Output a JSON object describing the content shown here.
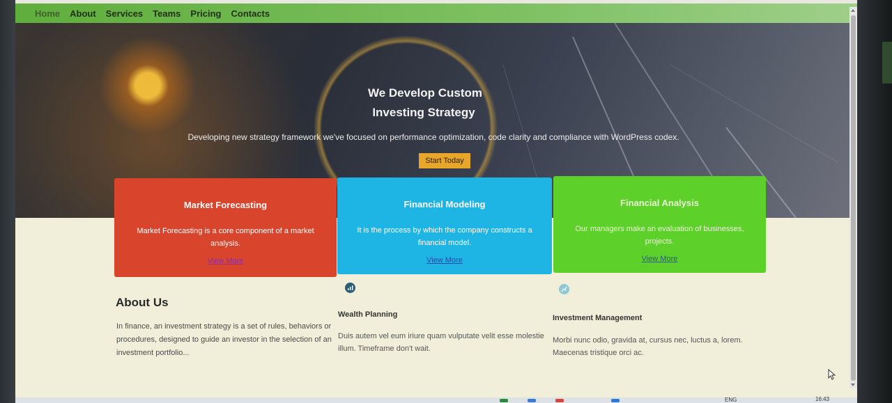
{
  "nav": {
    "items": [
      "Home",
      "About",
      "Services",
      "Teams",
      "Pricing",
      "Contacts"
    ]
  },
  "hero": {
    "title_line1": "We Develop Custom",
    "title_line2": "Investing Strategy",
    "subtitle": "Developing new strategy framework we've focused on performance optimization, code clarity and compliance with WordPress codex.",
    "cta_label": "Start Today"
  },
  "cards": [
    {
      "title": "Market Forecasting",
      "text": "Market Forecasting is a core component of a market analysis.",
      "link": "View More",
      "color": "#d9442c"
    },
    {
      "title": "Financial Modeling",
      "text": "It is the process by which the company constructs a financial model.",
      "link": "View More",
      "color": "#1eb4e4"
    },
    {
      "title": "Financial Analysis",
      "text": "Our managers make an evaluation of businesses, projects.",
      "link": "View More",
      "color": "#5ed02a"
    }
  ],
  "about": {
    "title": "About Us",
    "text": "In finance, an investment strategy is a set of rules, behaviors or procedures, designed to guide an investor in the selection of an investment portfolio..."
  },
  "features": [
    {
      "icon": "chart-icon",
      "title": "Wealth Planning",
      "text": "Duis autem vel eum iriure quam vulputate velit esse molestie illum. Timeframe don't wait."
    },
    {
      "icon": "growth-icon",
      "title": "Investment Management",
      "text": "Morbi nunc odio, gravida at, cursus nec, luctus a, lorem. Maecenas tristique orci ac."
    }
  ],
  "taskbar": {
    "language": "ENG",
    "time": "16:43"
  }
}
